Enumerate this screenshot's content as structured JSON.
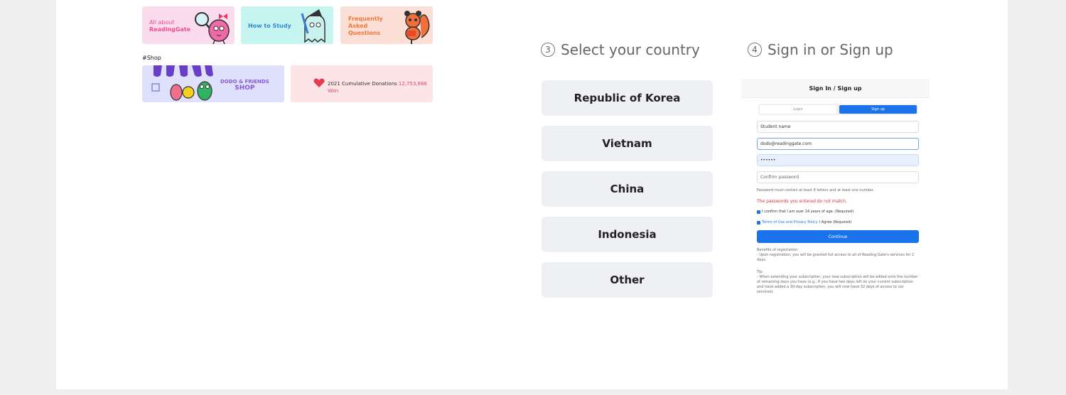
{
  "banners": {
    "about": {
      "line1": "All about",
      "line2": "ReadingGate"
    },
    "study": {
      "label": "How to Study"
    },
    "faq": {
      "l1": "Frequently",
      "l2": "Asked",
      "l3": "Questions"
    },
    "shop_section": "#Shop",
    "shop": {
      "line1": "DODO & FRIENDS",
      "line2": "SHOP"
    },
    "donations": {
      "label": "2021 Cumulative Donations",
      "amount": "12,753,666 Won"
    }
  },
  "step3": {
    "number": "3",
    "title": "Select your country"
  },
  "countries": [
    "Republic of Korea",
    "Vietnam",
    "China",
    "Indonesia",
    "Other"
  ],
  "step4": {
    "number": "4",
    "title": "Sign in or Sign up"
  },
  "signin": {
    "title": "Sign In / Sign up",
    "tab_login": "Login",
    "tab_signup": "Sign up",
    "student_name_placeholder": "Student name",
    "email_value": "dodo@readinggate.com",
    "password_value": "••••••",
    "confirm_placeholder": "Confirm password",
    "password_hint": "Password must contain at least 6 letters and at least one number.",
    "error": "The passwords you entered do not match.",
    "confirm_age": "I confirm that I am over 14 years of age. (Required)",
    "terms_link": "Terms of Use and Privacy Policy",
    "terms_suffix": "I Agree (Required)",
    "continue": "Continue",
    "benefits_title": "Benefits of registration:",
    "benefits_body": "- Upon registration, you will be granted full access to all of Reading Gate's services for 2 days.",
    "tip_title": "Tip:",
    "tip_body": "- When extending your subscription, your new subscription will be added onto the number of remaining days you have (e.g., If you have two days left on your current subscription and have added a 30-day subscription, you will now have 32 days of access to our services)."
  },
  "colors": {
    "accent": "#1a73e8",
    "error": "#e3342f",
    "button_bg": "#eff0f3"
  }
}
